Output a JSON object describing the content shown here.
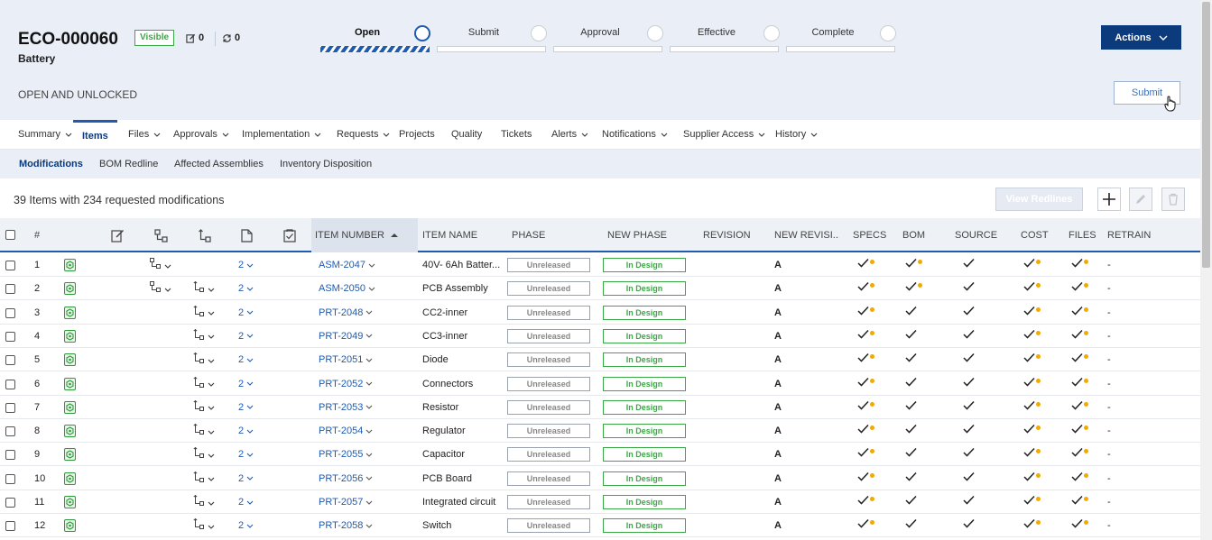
{
  "header": {
    "eco_id": "ECO-000060",
    "eco_name": "Battery",
    "visibility_badge": "Visible",
    "edit_count": "0",
    "sync_count": "0",
    "status_text": "OPEN AND UNLOCKED",
    "stages": [
      {
        "label": "Open",
        "active": true
      },
      {
        "label": "Submit",
        "active": false
      },
      {
        "label": "Approval",
        "active": false
      },
      {
        "label": "Effective",
        "active": false
      },
      {
        "label": "Complete",
        "active": false
      }
    ],
    "actions_label": "Actions",
    "submit_label": "Submit"
  },
  "tabs": [
    {
      "label": "Summary",
      "dropdown": true,
      "active": false
    },
    {
      "label": "Items",
      "dropdown": false,
      "active": true
    },
    {
      "label": "Files",
      "dropdown": true,
      "active": false
    },
    {
      "label": "Approvals",
      "dropdown": true,
      "active": false
    },
    {
      "label": "Implementation",
      "dropdown": true,
      "active": false
    },
    {
      "label": "Requests",
      "dropdown": true,
      "active": false
    },
    {
      "label": "Projects",
      "dropdown": false,
      "active": false
    },
    {
      "label": "Quality",
      "dropdown": false,
      "active": false
    },
    {
      "label": "Tickets",
      "dropdown": false,
      "active": false
    },
    {
      "label": "Alerts",
      "dropdown": true,
      "active": false
    },
    {
      "label": "Notifications",
      "dropdown": true,
      "active": false
    },
    {
      "label": "Supplier Access",
      "dropdown": true,
      "active": false
    },
    {
      "label": "History",
      "dropdown": true,
      "active": false
    }
  ],
  "subtabs": [
    {
      "label": "Modifications",
      "active": true
    },
    {
      "label": "BOM Redline",
      "active": false
    },
    {
      "label": "Affected Assemblies",
      "active": false
    },
    {
      "label": "Inventory Disposition",
      "active": false
    }
  ],
  "toolbar": {
    "summary": "39 Items with 234 requested modifications",
    "view_redlines": "View Redlines"
  },
  "columns": {
    "num": "#",
    "item_number": "ITEM NUMBER",
    "item_name": "ITEM NAME",
    "phase": "PHASE",
    "new_phase": "NEW PHASE",
    "revision": "REVISION",
    "new_revision": "NEW REVISI...",
    "specs": "SPECS",
    "bom": "BOM",
    "source": "SOURCE",
    "cost": "COST",
    "files": "FILES",
    "retrain": "RETRAIN"
  },
  "rows": [
    {
      "num": "1",
      "bom_struct": true,
      "where_used": false,
      "files": "2",
      "item_number": "ASM-2047",
      "item_name": "40V- 6Ah Batter...",
      "phase": "Unreleased",
      "new_phase": "In Design",
      "revision": "",
      "new_revision": "A",
      "specs_dot": true,
      "bom_dot": true,
      "cost_dot": true,
      "files_dot": true,
      "retrain": "-"
    },
    {
      "num": "2",
      "bom_struct": true,
      "where_used": true,
      "files": "2",
      "item_number": "ASM-2050",
      "item_name": "PCB Assembly",
      "phase": "Unreleased",
      "new_phase": "In Design",
      "revision": "",
      "new_revision": "A",
      "specs_dot": true,
      "bom_dot": true,
      "cost_dot": true,
      "files_dot": true,
      "retrain": "-"
    },
    {
      "num": "3",
      "bom_struct": false,
      "where_used": true,
      "files": "2",
      "item_number": "PRT-2048",
      "item_name": "CC2-inner",
      "phase": "Unreleased",
      "new_phase": "In Design",
      "revision": "",
      "new_revision": "A",
      "specs_dot": true,
      "bom_dot": false,
      "cost_dot": true,
      "files_dot": true,
      "retrain": "-"
    },
    {
      "num": "4",
      "bom_struct": false,
      "where_used": true,
      "files": "2",
      "item_number": "PRT-2049",
      "item_name": "CC3-inner",
      "phase": "Unreleased",
      "new_phase": "In Design",
      "revision": "",
      "new_revision": "A",
      "specs_dot": true,
      "bom_dot": false,
      "cost_dot": true,
      "files_dot": true,
      "retrain": "-"
    },
    {
      "num": "5",
      "bom_struct": false,
      "where_used": true,
      "files": "2",
      "item_number": "PRT-2051",
      "item_name": "Diode",
      "phase": "Unreleased",
      "new_phase": "In Design",
      "revision": "",
      "new_revision": "A",
      "specs_dot": true,
      "bom_dot": false,
      "cost_dot": true,
      "files_dot": true,
      "retrain": "-"
    },
    {
      "num": "6",
      "bom_struct": false,
      "where_used": true,
      "files": "2",
      "item_number": "PRT-2052",
      "item_name": "Connectors",
      "phase": "Unreleased",
      "new_phase": "In Design",
      "revision": "",
      "new_revision": "A",
      "specs_dot": true,
      "bom_dot": false,
      "cost_dot": true,
      "files_dot": true,
      "retrain": "-"
    },
    {
      "num": "7",
      "bom_struct": false,
      "where_used": true,
      "files": "2",
      "item_number": "PRT-2053",
      "item_name": "Resistor",
      "phase": "Unreleased",
      "new_phase": "In Design",
      "revision": "",
      "new_revision": "A",
      "specs_dot": true,
      "bom_dot": false,
      "cost_dot": true,
      "files_dot": true,
      "retrain": "-"
    },
    {
      "num": "8",
      "bom_struct": false,
      "where_used": true,
      "files": "2",
      "item_number": "PRT-2054",
      "item_name": "Regulator",
      "phase": "Unreleased",
      "new_phase": "In Design",
      "revision": "",
      "new_revision": "A",
      "specs_dot": true,
      "bom_dot": false,
      "cost_dot": true,
      "files_dot": true,
      "retrain": "-"
    },
    {
      "num": "9",
      "bom_struct": false,
      "where_used": true,
      "files": "2",
      "item_number": "PRT-2055",
      "item_name": "Capacitor",
      "phase": "Unreleased",
      "new_phase": "In Design",
      "revision": "",
      "new_revision": "A",
      "specs_dot": true,
      "bom_dot": false,
      "cost_dot": true,
      "files_dot": true,
      "retrain": "-"
    },
    {
      "num": "10",
      "bom_struct": false,
      "where_used": true,
      "files": "2",
      "item_number": "PRT-2056",
      "item_name": "PCB Board",
      "phase": "Unreleased",
      "new_phase": "In Design",
      "revision": "",
      "new_revision": "A",
      "specs_dot": true,
      "bom_dot": false,
      "cost_dot": true,
      "files_dot": true,
      "retrain": "-"
    },
    {
      "num": "11",
      "bom_struct": false,
      "where_used": true,
      "files": "2",
      "item_number": "PRT-2057",
      "item_name": "Integrated circuit",
      "phase": "Unreleased",
      "new_phase": "In Design",
      "revision": "",
      "new_revision": "A",
      "specs_dot": true,
      "bom_dot": false,
      "cost_dot": true,
      "files_dot": true,
      "retrain": "-"
    },
    {
      "num": "12",
      "bom_struct": false,
      "where_used": true,
      "files": "2",
      "item_number": "PRT-2058",
      "item_name": "Switch",
      "phase": "Unreleased",
      "new_phase": "In Design",
      "revision": "",
      "new_revision": "A",
      "specs_dot": true,
      "bom_dot": false,
      "cost_dot": true,
      "files_dot": true,
      "retrain": "-"
    }
  ],
  "colors": {
    "brand": "#0b3a7d",
    "accent": "#1f5bb0",
    "in_design": "#3aa845",
    "warning_dot": "#f2a900"
  }
}
